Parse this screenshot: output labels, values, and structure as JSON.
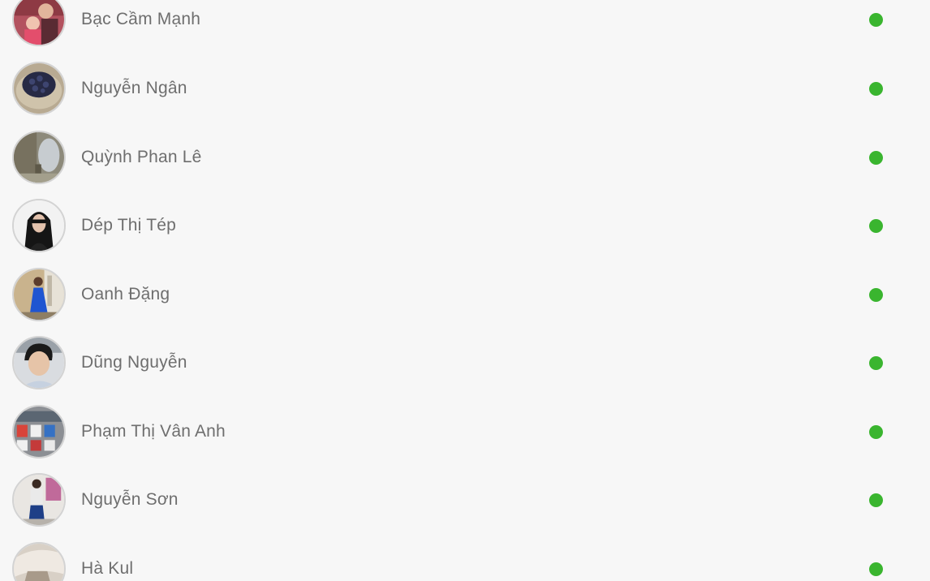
{
  "status_colors": {
    "online": "#3ab52f"
  },
  "contacts": [
    {
      "name": "Bạc Cầm Mạnh",
      "status": "online",
      "avatar": "avatar-photo-1-icon"
    },
    {
      "name": "Nguyễn Ngân",
      "status": "online",
      "avatar": "avatar-photo-2-icon"
    },
    {
      "name": "Quỳnh Phan Lê",
      "status": "online",
      "avatar": "avatar-photo-3-icon"
    },
    {
      "name": "Dép Thị Tép",
      "status": "online",
      "avatar": "avatar-photo-4-icon"
    },
    {
      "name": "Oanh Đặng",
      "status": "online",
      "avatar": "avatar-photo-5-icon"
    },
    {
      "name": "Dũng Nguyễn",
      "status": "online",
      "avatar": "avatar-photo-6-icon"
    },
    {
      "name": "Phạm Thị Vân Anh",
      "status": "online",
      "avatar": "avatar-photo-7-icon"
    },
    {
      "name": "Nguyễn Sơn",
      "status": "online",
      "avatar": "avatar-photo-8-icon"
    },
    {
      "name": "Hà Kul",
      "status": "online",
      "avatar": "avatar-photo-9-icon"
    }
  ]
}
